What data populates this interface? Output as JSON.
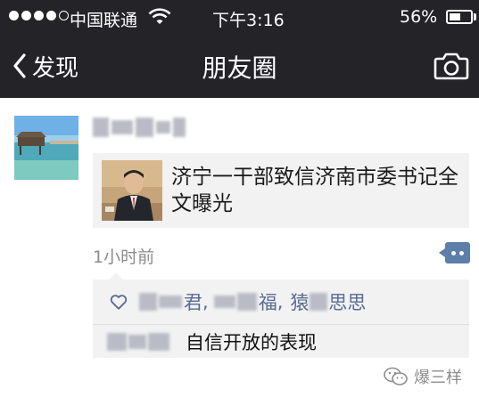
{
  "status_bar": {
    "carrier": "中国联通",
    "time": "下午3:16",
    "battery_percent": "56%",
    "battery_level": 0.56,
    "signal_strength": 4,
    "signal_max": 5,
    "icons": [
      "signal-dots-icon",
      "wifi-icon",
      "battery-icon"
    ]
  },
  "nav": {
    "back_label": "发现",
    "title": "朋友圈",
    "icons": [
      "chevron-left-icon",
      "camera-icon"
    ]
  },
  "post": {
    "shared_link": {
      "title": "济宁一干部致信济南市委书记全文曝光"
    },
    "timestamp": "1小时前",
    "likes": {
      "icon": "heart-icon",
      "names": [
        {
          "visible": "君",
          "suffix": ", "
        },
        {
          "visible": "福",
          "suffix": ", "
        },
        {
          "visible": "猿",
          "suffix": ""
        },
        {
          "visible": "思思",
          "suffix": ""
        }
      ]
    },
    "comment": {
      "text": "自信开放的表现"
    }
  },
  "watermark": {
    "text": "爆三样",
    "icon": "wechat-logo-icon"
  },
  "colors": {
    "bar_background": "#242428",
    "link_blue": "#576b95",
    "card_background": "#f2f2f2"
  }
}
